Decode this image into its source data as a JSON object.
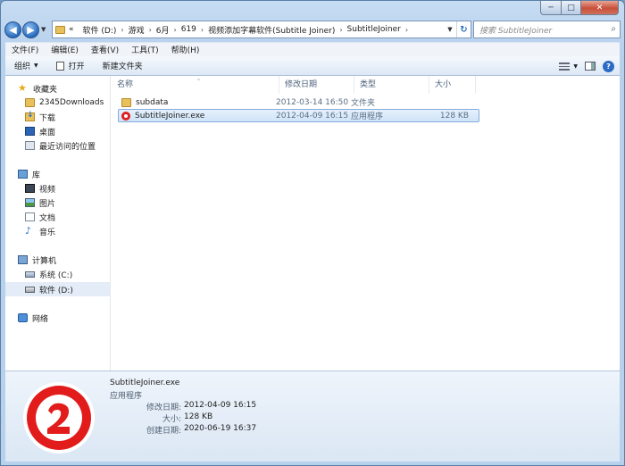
{
  "window": {
    "min_label": "─",
    "max_label": "□",
    "close_label": "✕"
  },
  "nav": {
    "back_label": "◀",
    "forward_label": "▶",
    "dropdown_label": "▼"
  },
  "address": {
    "overflow": "«",
    "crumbs": [
      "软件 (D:)",
      "游戏",
      "6月",
      "619",
      "视频添加字幕软件(Subtitle Joiner)",
      "SubtitleJoiner"
    ],
    "sep": "›",
    "drop": "▼",
    "refresh": "↻"
  },
  "search": {
    "placeholder": "搜索 SubtitleJoiner",
    "icon": "⌕"
  },
  "menu": [
    "文件(F)",
    "编辑(E)",
    "查看(V)",
    "工具(T)",
    "帮助(H)"
  ],
  "toolbar": {
    "organize": "组织",
    "organize_dd": "▼",
    "open": "打开",
    "new_folder": "新建文件夹",
    "views_dd": "▼",
    "help": "?"
  },
  "sidebar": {
    "favorites": "收藏夹",
    "fav_items": [
      "2345Downloads",
      "下载",
      "桌面",
      "最近访问的位置"
    ],
    "libraries": "库",
    "lib_items": [
      "视频",
      "图片",
      "文档",
      "音乐"
    ],
    "computer": "计算机",
    "drives": [
      "系统 (C:)",
      "软件 (D:)"
    ],
    "network": "网络"
  },
  "columns": {
    "name": "名称",
    "date": "修改日期",
    "type": "类型",
    "size": "大小",
    "sort_arrow": "^"
  },
  "files": [
    {
      "name": "subdata",
      "date": "2012-03-14 16:50",
      "type": "文件夹",
      "size": ""
    },
    {
      "name": "SubtitleJoiner.exe",
      "date": "2012-04-09 16:15",
      "type": "应用程序",
      "size": "128 KB"
    }
  ],
  "details": {
    "name": "SubtitleJoiner.exe",
    "type": "应用程序",
    "modified_label": "修改日期:",
    "modified": "2012-04-09 16:15",
    "size_label": "大小:",
    "size": "128 KB",
    "created_label": "创建日期:",
    "created": "2020-06-19 16:37"
  },
  "colors": {
    "app_red": "#e21b1b",
    "selection": "#cfe3f8"
  }
}
